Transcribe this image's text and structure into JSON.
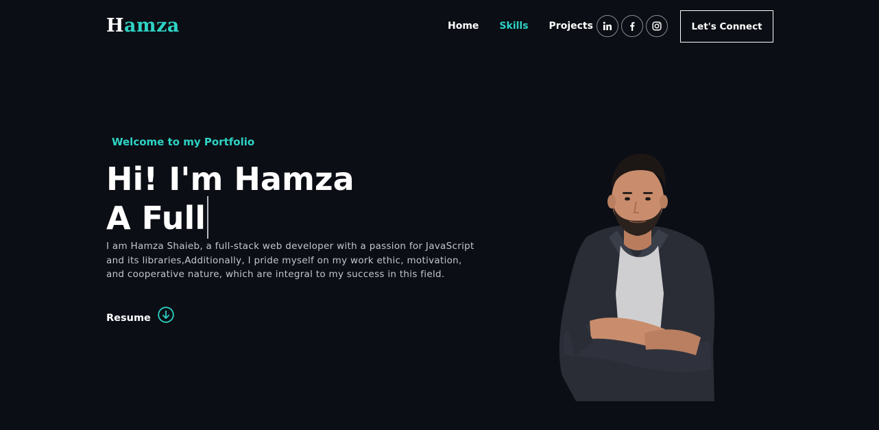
{
  "nav": {
    "logo_first": "H",
    "logo_rest": "amza",
    "links": [
      {
        "label": "Home"
      },
      {
        "label": "Skills"
      },
      {
        "label": "Projects"
      }
    ],
    "socials": [
      {
        "icon": "linkedin-icon",
        "glyph": "in"
      },
      {
        "icon": "facebook-icon",
        "glyph": "f"
      },
      {
        "icon": "instagram-icon"
      }
    ],
    "cta_label": "Let's Connect"
  },
  "hero": {
    "tagline": "Welcome to my Portfolio",
    "heading_line1": "Hi! I'm Hamza",
    "heading_line2": "A Full",
    "bio": "I am Hamza Shaieb, a full-stack web developer with a passion for JavaScript and its libraries,Additionally, I pride myself on my work ethic, motivation, and cooperative nature, which are integral to my success in this field.",
    "resume_label": "Resume",
    "resume_icon": "arrow-down-circle-icon"
  },
  "colors": {
    "background": "#0b0e14",
    "accent": "#2ed3c6",
    "text": "#ffffff",
    "muted_text": "#c4c7cc"
  }
}
